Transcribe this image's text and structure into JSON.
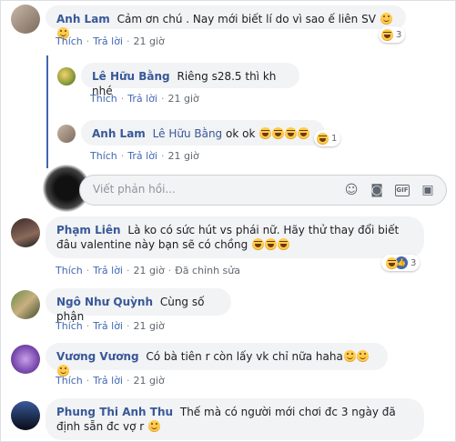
{
  "comments": [
    {
      "name": "Anh Lam",
      "text": "Cảm ơn chú . Nay mới biết lí do vì sao ế liên SV",
      "emojis": "smile smile",
      "actions": {
        "like": "Thích",
        "reply": "Trả lời",
        "time": "21 giờ"
      },
      "reaction_count": "3"
    },
    {
      "name": "Lê Hữu Bằng",
      "text": "Riêng s28.5 thì kh nhé",
      "actions": {
        "like": "Thích",
        "reply": "Trả lời",
        "time": "21 giờ"
      }
    },
    {
      "name": "Anh Lam",
      "tag": "Lê Hữu Bằng",
      "text": "ok ok",
      "actions": {
        "like": "Thích",
        "reply": "Trả lời",
        "time": "21 giờ"
      },
      "reaction_count": "1"
    },
    {
      "name": "Phạm Liên",
      "text": "Là ko có sức hút vs phái nữ. Hãy thử thay đổi biết đâu valentine này bạn sẽ có chồng",
      "actions": {
        "like": "Thích",
        "reply": "Trả lời",
        "time": "21 giờ",
        "edited": "Đã chỉnh sửa"
      },
      "reaction_count": "3"
    },
    {
      "name": "Ngô Như Quỳnh",
      "text": "Cùng số phận",
      "actions": {
        "like": "Thích",
        "reply": "Trả lời",
        "time": "21 giờ"
      }
    },
    {
      "name": "Vương Vương",
      "text": "Có bà tiên r còn lấy vk chỉ nữa haha",
      "actions": {
        "like": "Thích",
        "reply": "Trả lời",
        "time": "21 giờ"
      }
    },
    {
      "name": "Phung Thi Anh Thu",
      "text": "Thế mà có người mới chơi đc 3 ngày đã định sẵn đc vợ r"
    }
  ],
  "reply_box": {
    "placeholder": "Viết phản hồi...",
    "icons": [
      "emoji-icon",
      "camera-icon",
      "gif-icon",
      "sticker-icon"
    ]
  },
  "colors": {
    "link": "#385898",
    "action": "#4267b2",
    "bubble": "#f2f3f5"
  }
}
